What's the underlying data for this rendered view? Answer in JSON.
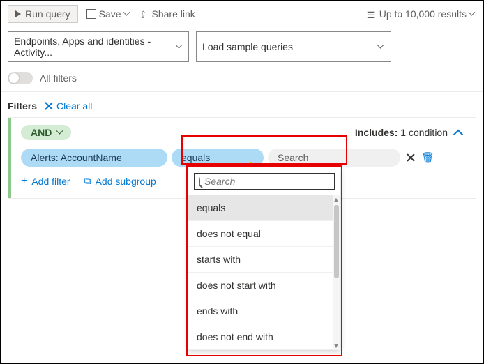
{
  "toolbar": {
    "run_label": "Run query",
    "save_label": "Save",
    "share_label": "Share link",
    "results_label": "Up to 10,000 results"
  },
  "dropdowns": {
    "tables": "Endpoints, Apps and identities - Activity...",
    "sample": "Load sample queries"
  },
  "filters_toggle_label": "All filters",
  "filters_header": {
    "title": "Filters",
    "clear": "Clear all"
  },
  "group": {
    "operator": "AND",
    "includes_label": "Includes:",
    "includes_count": "1 condition"
  },
  "condition": {
    "field": "Alerts: AccountName",
    "operator": "equals",
    "value_placeholder": "Search"
  },
  "actions": {
    "add_filter": "Add filter",
    "add_subgroup": "Add subgroup"
  },
  "operator_popup": {
    "search_placeholder": "Search",
    "options": [
      "equals",
      "does not equal",
      "starts with",
      "does not start with",
      "ends with",
      "does not end with"
    ],
    "selected": "equals"
  }
}
